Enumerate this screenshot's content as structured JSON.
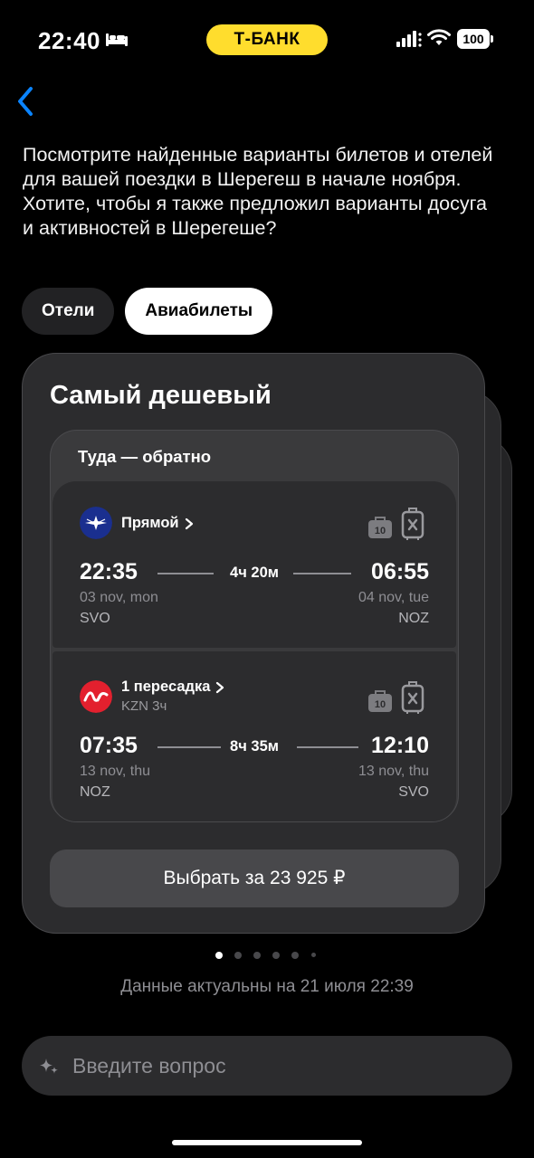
{
  "status_bar": {
    "time": "22:40",
    "brand": "Т-БАНК",
    "brand_color": "#ffdd2d",
    "battery": "100",
    "icons": [
      "bed-icon",
      "signal-icon",
      "wifi-icon",
      "battery-icon"
    ]
  },
  "nav": {
    "back_icon": "chevron-left-icon",
    "accent": "#0a84ff"
  },
  "message": "Посмотрите найденные варианты билетов и отелей для вашей поездки в Шерегеш в начале ноября. Хотите, чтобы я также предложил варианты досуга и активностей в Шерегеше?",
  "tabs": [
    {
      "label": "Отели",
      "active": false
    },
    {
      "label": "Авиабилеты",
      "active": true
    }
  ],
  "card": {
    "title": "Самый дешевый",
    "trip_type": "Туда — обратно",
    "segments": [
      {
        "airline_logo": "aeroflot-logo-icon",
        "kind": "Прямой",
        "sub": "",
        "baggage": "10",
        "dep_time": "22:35",
        "duration": "4ч 20м",
        "arr_time": "06:55",
        "dep_date": "03 nov, mon",
        "arr_date": "04 nov, tue",
        "dep_code": "SVO",
        "arr_code": "NOZ"
      },
      {
        "airline_logo": "nordwind-logo-icon",
        "kind": "1 пересадка",
        "sub": "KZN 3ч",
        "baggage": "10",
        "dep_time": "07:35",
        "duration": "8ч 35м",
        "arr_time": "12:10",
        "dep_date": "13 nov, thu",
        "arr_date": "13 nov, thu",
        "dep_code": "NOZ",
        "arr_code": "SVO"
      }
    ],
    "select_label": "Выбрать за 23 925 ₽"
  },
  "pagination": {
    "count": 6,
    "active_index": 0
  },
  "updated": "Данные актуальны на 21 июля 22:39",
  "input": {
    "placeholder": "Введите вопрос",
    "icon": "sparkle-icon"
  }
}
